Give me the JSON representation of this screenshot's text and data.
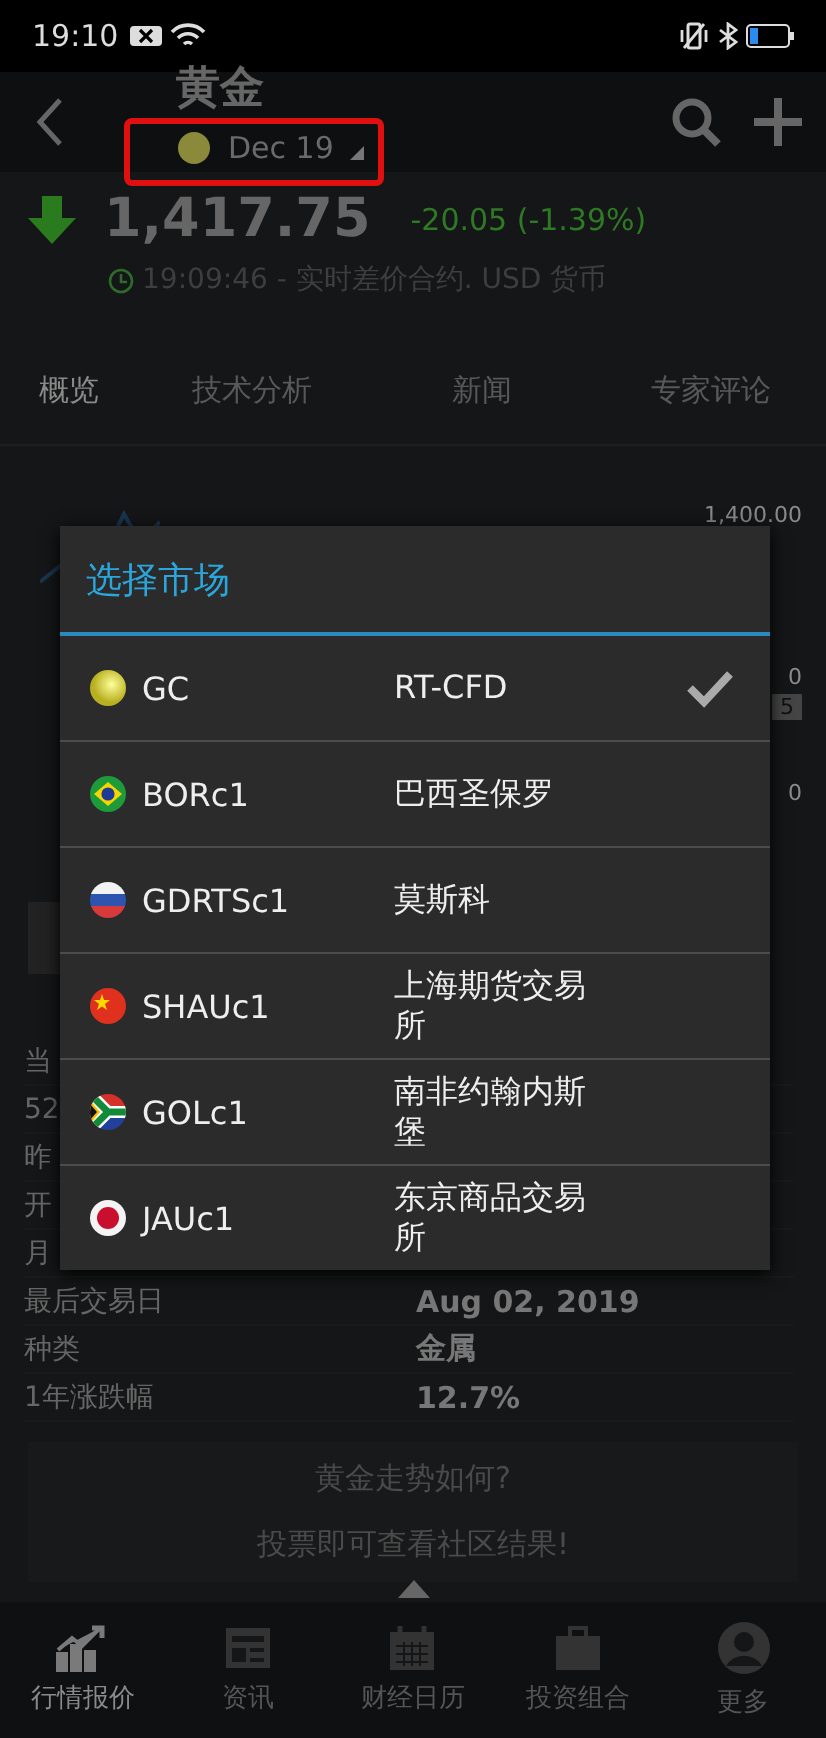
{
  "status_bar": {
    "time": "19:10"
  },
  "header": {
    "title": "黄金",
    "contract": "Dec 19"
  },
  "quote": {
    "price": "1,417.75",
    "change": "-20.05 (-1.39%)",
    "time_line": "19:09:46 - 实时差价合约. USD 货币"
  },
  "tabs": [
    {
      "label": "概览",
      "selected": true
    },
    {
      "label": "技术分析",
      "selected": false
    },
    {
      "label": "新闻",
      "selected": false
    },
    {
      "label": "专家评论",
      "selected": false
    }
  ],
  "chart": {
    "axis_labels": [
      "1,400.00",
      "0",
      "5",
      "0"
    ]
  },
  "details": [
    {
      "label": "当"
    },
    {
      "label": "52"
    },
    {
      "label": "昨"
    },
    {
      "label": "开"
    },
    {
      "label": "月"
    },
    {
      "label": "最后交易日",
      "value": "Aug 02, 2019"
    },
    {
      "label": "种类",
      "value": "金属"
    },
    {
      "label": "1年涨跌幅",
      "value": "12.7%"
    }
  ],
  "vote": {
    "question": "黄金走势如何?",
    "prompt": "投票即可查看社区结果!"
  },
  "nav": [
    {
      "label": "行情报价",
      "kind": "chart",
      "selected": true
    },
    {
      "label": "资讯",
      "kind": "news",
      "selected": false
    },
    {
      "label": "财经日历",
      "kind": "calendar",
      "selected": false
    },
    {
      "label": "投资组合",
      "kind": "briefcase",
      "selected": false
    },
    {
      "label": "更多",
      "kind": "person",
      "selected": false
    }
  ],
  "dialog": {
    "title": "选择市场",
    "markets": [
      {
        "code": "GC",
        "exchange": "RT-CFD",
        "kind": "gold",
        "selected": true
      },
      {
        "code": "BORc1",
        "exchange": "巴西圣保罗",
        "kind": "brazil",
        "selected": false
      },
      {
        "code": "GDRTSc1",
        "exchange": "莫斯科",
        "kind": "russia",
        "selected": false
      },
      {
        "code": "SHAUc1",
        "exchange": "上海期货交易所",
        "kind": "china",
        "selected": false
      },
      {
        "code": "GOLc1",
        "exchange": "南非约翰内斯堡",
        "kind": "south_africa",
        "selected": false
      },
      {
        "code": "JAUc1",
        "exchange": "东京商品交易所",
        "kind": "japan",
        "selected": false
      }
    ]
  }
}
